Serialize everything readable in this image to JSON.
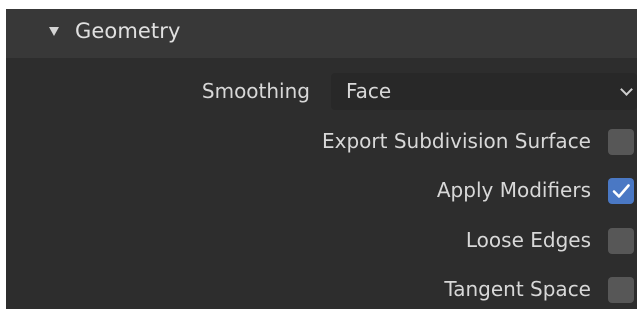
{
  "panel": {
    "title": "Geometry",
    "expanded": true,
    "header_icon": "triangle-down-icon"
  },
  "smoothing": {
    "label": "Smoothing",
    "value": "Face",
    "icon": "chevron-down-icon"
  },
  "options": [
    {
      "label": "Export Subdivision Surface",
      "checked": false
    },
    {
      "label": "Apply Modifiers",
      "checked": true
    },
    {
      "label": "Loose Edges",
      "checked": false
    },
    {
      "label": "Tangent Space",
      "checked": false
    }
  ],
  "colors": {
    "panel_bg": "#2d2d2d",
    "header_bg": "#383838",
    "checkbox_off": "#575757",
    "checkbox_on": "#4a78c4",
    "text": "#d8d8d8"
  }
}
